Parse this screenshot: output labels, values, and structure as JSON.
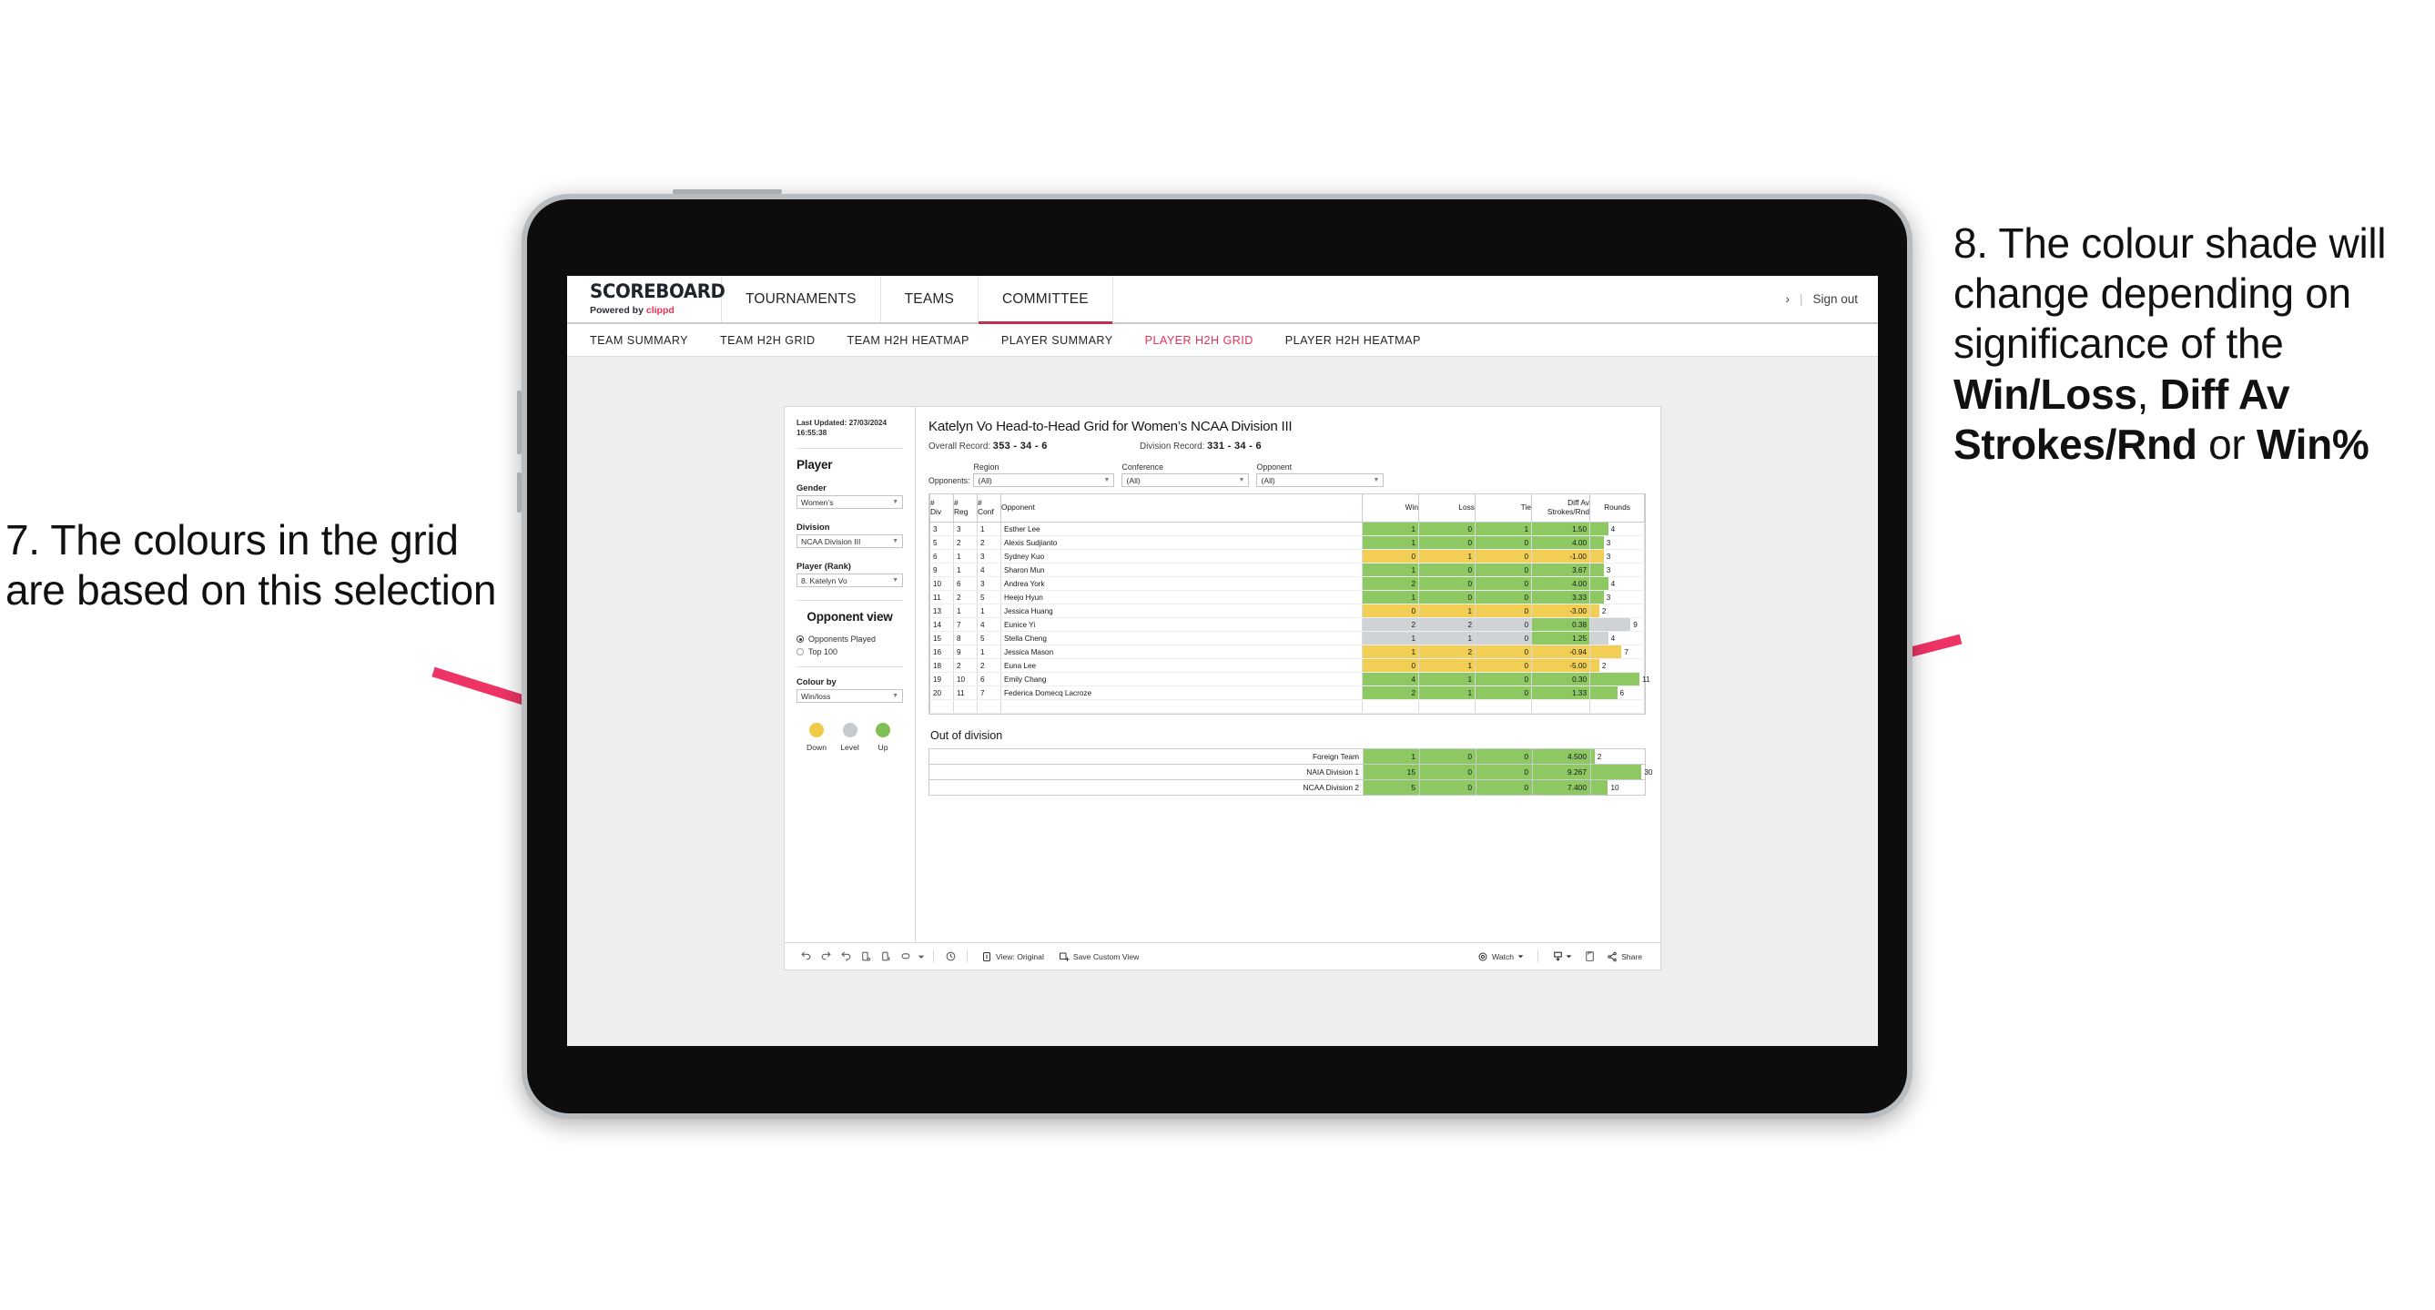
{
  "annotations": {
    "left": "7. The colours in the grid are based on this selection",
    "right_pre": "8. The colour shade will change depending on significance of the ",
    "right_b1": "Win/Loss",
    "right_mid1": ", ",
    "right_b2": "Diff Av Strokes/Rnd",
    "right_mid2": " or ",
    "right_b3": "Win%"
  },
  "header": {
    "logo_main": "SCOREBOARD",
    "logo_sub_pre": "Powered by ",
    "logo_sub_brand": "clippd",
    "nav": [
      {
        "label": "TOURNAMENTS",
        "active": false
      },
      {
        "label": "TEAMS",
        "active": false
      },
      {
        "label": "COMMITTEE",
        "active": true
      }
    ],
    "chevron": "›",
    "separator": "|",
    "sign_out": "Sign out"
  },
  "subnav": {
    "items": [
      {
        "label": "TEAM SUMMARY",
        "active": false
      },
      {
        "label": "TEAM H2H GRID",
        "active": false
      },
      {
        "label": "TEAM H2H HEATMAP",
        "active": false
      },
      {
        "label": "PLAYER SUMMARY",
        "active": false
      },
      {
        "label": "PLAYER H2H GRID",
        "active": true
      },
      {
        "label": "PLAYER H2H HEATMAP",
        "active": false
      }
    ]
  },
  "sidebar": {
    "last_updated_line1": "Last Updated: 27/03/2024",
    "last_updated_line2": "16:55:38",
    "player_heading": "Player",
    "gender_label": "Gender",
    "gender_value": "Women’s",
    "division_label": "Division",
    "division_value": "NCAA Division III",
    "player_rank_label": "Player (Rank)",
    "player_rank_value": "8. Katelyn Vo",
    "opponent_view_heading": "Opponent view",
    "opponent_view_options": [
      {
        "label": "Opponents Played",
        "selected": true
      },
      {
        "label": "Top 100",
        "selected": false
      }
    ],
    "colour_by_label": "Colour by",
    "colour_by_value": "Win/loss",
    "legend": [
      {
        "label": "Down",
        "color": "#EFCB45"
      },
      {
        "label": "Level",
        "color": "#C6CACD"
      },
      {
        "label": "Up",
        "color": "#7FBF55"
      }
    ]
  },
  "main": {
    "title": "Katelyn Vo Head-to-Head Grid for Women’s NCAA Division III",
    "overall_record_label": "Overall Record:",
    "overall_record_value": "353 - 34 - 6",
    "division_record_label": "Division Record:",
    "division_record_value": "331 - 34 - 6",
    "opponents_label": "Opponents:",
    "filters": [
      {
        "label": "Region",
        "value": "(All)"
      },
      {
        "label": "Conference",
        "value": "(All)"
      },
      {
        "label": "Opponent",
        "value": "(All)"
      }
    ],
    "out_of_division_title": "Out of division"
  },
  "chart_data": {
    "type": "table",
    "title": "Katelyn Vo Head-to-Head Grid for Women’s NCAA Division III",
    "columns": [
      {
        "line1": "#",
        "line2": "Div"
      },
      {
        "line1": "#",
        "line2": "Reg"
      },
      {
        "line1": "#",
        "line2": "Conf"
      },
      {
        "line1": "Opponent",
        "line2": ""
      },
      {
        "line1": "Win",
        "line2": ""
      },
      {
        "line1": "Loss",
        "line2": ""
      },
      {
        "line1": "Tie",
        "line2": ""
      },
      {
        "line1": "Diff Av",
        "line2": "Strokes/Rnd"
      },
      {
        "line1": "Rounds",
        "line2": ""
      }
    ],
    "rounds_max": 12,
    "colors": {
      "up": "#8DC863",
      "down": "#F2CE54",
      "level": "#D0D3D6",
      "white": "#FFFFFF"
    },
    "rows": [
      {
        "div": "3",
        "reg": "3",
        "conf": "1",
        "opponent": "Esther Lee",
        "win": "1",
        "loss": "0",
        "tie": "1",
        "diff": "1.50",
        "rounds": "4",
        "shade": "up"
      },
      {
        "div": "5",
        "reg": "2",
        "conf": "2",
        "opponent": "Alexis Sudjianto",
        "win": "1",
        "loss": "0",
        "tie": "0",
        "diff": "4.00",
        "rounds": "3",
        "shade": "up"
      },
      {
        "div": "6",
        "reg": "1",
        "conf": "3",
        "opponent": "Sydney Kuo",
        "win": "0",
        "loss": "1",
        "tie": "0",
        "diff": "-1.00",
        "rounds": "3",
        "shade": "down"
      },
      {
        "div": "9",
        "reg": "1",
        "conf": "4",
        "opponent": "Sharon Mun",
        "win": "1",
        "loss": "0",
        "tie": "0",
        "diff": "3.67",
        "rounds": "3",
        "shade": "up"
      },
      {
        "div": "10",
        "reg": "6",
        "conf": "3",
        "opponent": "Andrea York",
        "win": "2",
        "loss": "0",
        "tie": "0",
        "diff": "4.00",
        "rounds": "4",
        "shade": "up"
      },
      {
        "div": "11",
        "reg": "2",
        "conf": "5",
        "opponent": "Heejo Hyun",
        "win": "1",
        "loss": "0",
        "tie": "0",
        "diff": "3.33",
        "rounds": "3",
        "shade": "up"
      },
      {
        "div": "13",
        "reg": "1",
        "conf": "1",
        "opponent": "Jessica Huang",
        "win": "0",
        "loss": "1",
        "tie": "0",
        "diff": "-3.00",
        "rounds": "2",
        "shade": "down"
      },
      {
        "div": "14",
        "reg": "7",
        "conf": "4",
        "opponent": "Eunice Yi",
        "win": "2",
        "loss": "2",
        "tie": "0",
        "diff": "0.38",
        "rounds": "9",
        "shade": "level",
        "diff_shade": "up"
      },
      {
        "div": "15",
        "reg": "8",
        "conf": "5",
        "opponent": "Stella Cheng",
        "win": "1",
        "loss": "1",
        "tie": "0",
        "diff": "1.25",
        "rounds": "4",
        "shade": "level",
        "diff_shade": "up"
      },
      {
        "div": "16",
        "reg": "9",
        "conf": "1",
        "opponent": "Jessica Mason",
        "win": "1",
        "loss": "2",
        "tie": "0",
        "diff": "-0.94",
        "rounds": "7",
        "shade": "down"
      },
      {
        "div": "18",
        "reg": "2",
        "conf": "2",
        "opponent": "Euna Lee",
        "win": "0",
        "loss": "1",
        "tie": "0",
        "diff": "-5.00",
        "rounds": "2",
        "shade": "down"
      },
      {
        "div": "19",
        "reg": "10",
        "conf": "6",
        "opponent": "Emily Chang",
        "win": "4",
        "loss": "1",
        "tie": "0",
        "diff": "0.30",
        "rounds": "11",
        "shade": "up"
      },
      {
        "div": "20",
        "reg": "11",
        "conf": "7",
        "opponent": "Federica Domecq Lacroze",
        "win": "2",
        "loss": "1",
        "tie": "0",
        "diff": "1.33",
        "rounds": "6",
        "shade": "up"
      }
    ],
    "out_of_division": {
      "rounds_max": 32,
      "rows": [
        {
          "name": "Foreign Team",
          "win": "1",
          "loss": "0",
          "tie": "0",
          "diff": "4.500",
          "rounds": "2",
          "shade": "up"
        },
        {
          "name": "NAIA Division 1",
          "win": "15",
          "loss": "0",
          "tie": "0",
          "diff": "9.267",
          "rounds": "30",
          "shade": "up"
        },
        {
          "name": "NCAA Division 2",
          "win": "5",
          "loss": "0",
          "tie": "0",
          "diff": "7.400",
          "rounds": "10",
          "shade": "up"
        }
      ]
    }
  },
  "toolbar": {
    "view_label": "View: Original",
    "save_label": "Save Custom View",
    "watch_label": "Watch",
    "share_label": "Share"
  }
}
